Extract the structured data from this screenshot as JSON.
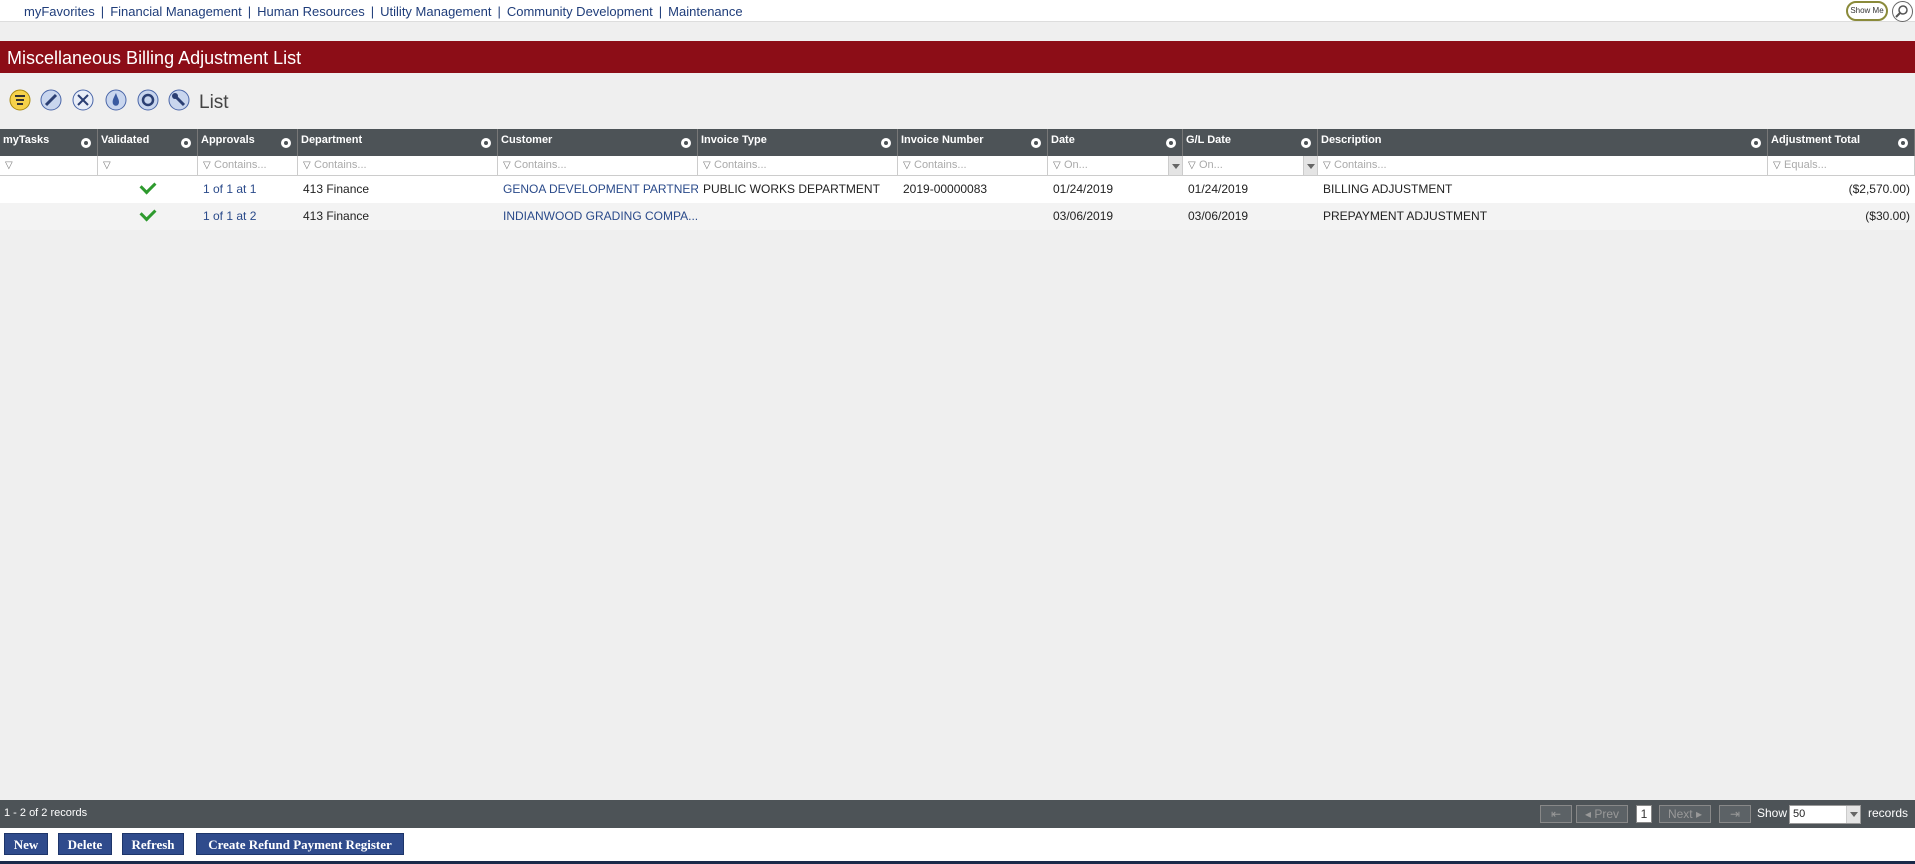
{
  "nav": {
    "links": [
      "myFavorites",
      "Financial Management",
      "Human Resources",
      "Utility Management",
      "Community Development",
      "Maintenance"
    ],
    "show_me": "Show Me"
  },
  "page": {
    "title": "Miscellaneous Billing Adjustment List"
  },
  "toolbar": {
    "label": "List",
    "icons": [
      "list-filter-icon",
      "edit-icon",
      "clear-icon",
      "drop-icon",
      "refresh-cycle-icon",
      "tools-icon"
    ]
  },
  "grid": {
    "columns": [
      "myTasks",
      "Validated",
      "Approvals",
      "Department",
      "Customer",
      "Invoice Type",
      "Invoice Number",
      "Date",
      "G/L Date",
      "Description",
      "Adjustment Total"
    ],
    "filters": [
      "",
      "",
      "Contains...",
      "Contains...",
      "Contains...",
      "Contains...",
      "Contains...",
      "On...",
      "On...",
      "Contains...",
      "Equals..."
    ],
    "rows": [
      {
        "validated": true,
        "approvals": "1 of 1 at 1",
        "department": "413 Finance",
        "customer": "GENOA DEVELOPMENT PARTNERS",
        "invoice_type": "PUBLIC WORKS DEPARTMENT",
        "invoice_number": "2019-00000083",
        "date": "01/24/2019",
        "gl_date": "01/24/2019",
        "description": "BILLING ADJUSTMENT",
        "adjustment_total": "($2,570.00)"
      },
      {
        "validated": true,
        "approvals": "1 of 1 at 2",
        "department": "413 Finance",
        "customer": "INDIANWOOD GRADING COMPA...",
        "invoice_type": "",
        "invoice_number": "",
        "date": "03/06/2019",
        "gl_date": "03/06/2019",
        "description": "PREPAYMENT ADJUSTMENT",
        "adjustment_total": "($30.00)"
      }
    ]
  },
  "status": {
    "count": "1 - 2 of 2 records",
    "prev": "Prev",
    "page": "1",
    "next": "Next",
    "show_label": "Show",
    "show_value": "50",
    "records_label": "records"
  },
  "buttons": {
    "new": "New",
    "delete": "Delete",
    "refresh": "Refresh",
    "create_refund": "Create Refund Payment Register"
  }
}
